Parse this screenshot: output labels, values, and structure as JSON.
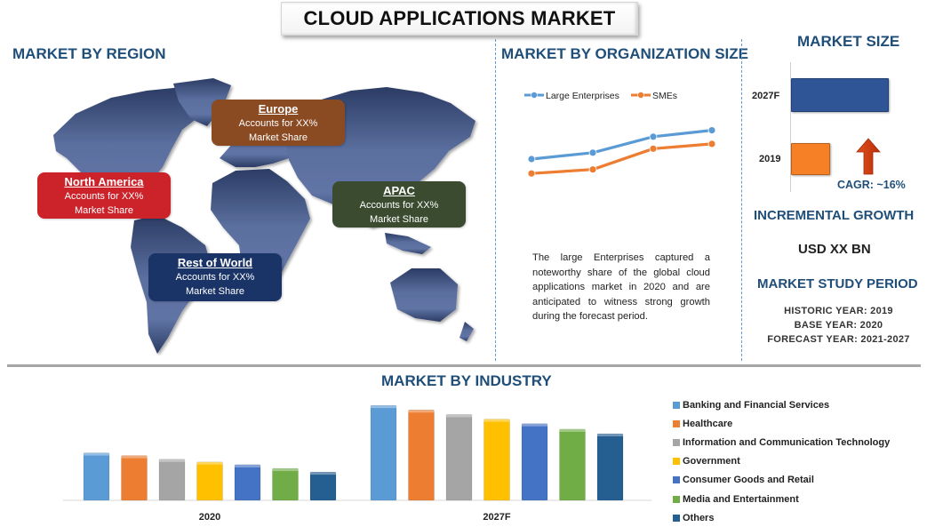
{
  "title": "CLOUD APPLICATIONS MARKET",
  "region": {
    "heading": "MARKET BY REGION",
    "cards": [
      {
        "name": "North America",
        "line1": "Accounts for XX%",
        "line2": "Market Share",
        "color": "#cc2229"
      },
      {
        "name": "Europe",
        "line1": "Accounts for XX%",
        "line2": "Market Share",
        "color": "#8a4a22"
      },
      {
        "name": "APAC",
        "line1": "Accounts for XX%",
        "line2": "Market Share",
        "color": "#3a4b30"
      },
      {
        "name": "Rest of World",
        "line1": "Accounts for XX%",
        "line2": "Market Share",
        "color": "#1b3468"
      }
    ]
  },
  "organization": {
    "heading": "MARKET BY ORGANIZATION SIZE",
    "description": "The large Enterprises captured a noteworthy share of the global cloud applications market in 2020 and are anticipated to witness strong growth during the forecast period."
  },
  "market_size": {
    "heading": "MARKET SIZE",
    "years": [
      "2027F",
      "2019"
    ],
    "cagr": "CAGR: ~16%",
    "colors": {
      "2027F": "#2f5597",
      "2019": "#f58025",
      "arrow": "#d63e12"
    }
  },
  "incremental": {
    "heading": "INCREMENTAL GROWTH",
    "value": "USD XX BN"
  },
  "study_period": {
    "heading": "MARKET STUDY PERIOD",
    "historic": "HISTORIC YEAR: 2019",
    "base": "BASE YEAR: 2020",
    "forecast": "FORECAST YEAR: 2021-2027"
  },
  "industry": {
    "heading": "MARKET BY INDUSTRY"
  },
  "chart_data": [
    {
      "type": "line",
      "title": "Market by Organization Size",
      "x": [
        1,
        2,
        3,
        4
      ],
      "series": [
        {
          "name": "Large Enterprises",
          "values": [
            40,
            48,
            68,
            76
          ],
          "color": "#5b9bd5"
        },
        {
          "name": "SMEs",
          "values": [
            22,
            27,
            53,
            59
          ],
          "color": "#ed7d31"
        }
      ],
      "ylim": [
        0,
        100
      ],
      "legend": "top",
      "grid": false
    },
    {
      "type": "bar",
      "title": "Market Size",
      "orientation": "horizontal",
      "categories": [
        "2027F",
        "2019"
      ],
      "values": [
        100,
        40
      ],
      "annotation": "CAGR: ~16%"
    },
    {
      "type": "bar",
      "title": "Market by Industry",
      "categories": [
        "2020",
        "2027F"
      ],
      "series": [
        {
          "name": "Banking and Financial Services",
          "values": [
            52,
            104
          ],
          "color": "#5b9bd5"
        },
        {
          "name": "Healthcare",
          "values": [
            49,
            99
          ],
          "color": "#ed7d31"
        },
        {
          "name": "Information and Communication Technology",
          "values": [
            45,
            94
          ],
          "color": "#a5a5a5"
        },
        {
          "name": "Government",
          "values": [
            42,
            89
          ],
          "color": "#ffc000"
        },
        {
          "name": "Consumer Goods and Retail",
          "values": [
            39,
            84
          ],
          "color": "#4472c4"
        },
        {
          "name": "Media and Entertainment",
          "values": [
            35,
            78
          ],
          "color": "#70ad47"
        },
        {
          "name": "Others",
          "values": [
            31,
            73
          ],
          "color": "#255e91"
        }
      ],
      "ylim": [
        0,
        110
      ],
      "legend": "right",
      "grid": false
    }
  ]
}
